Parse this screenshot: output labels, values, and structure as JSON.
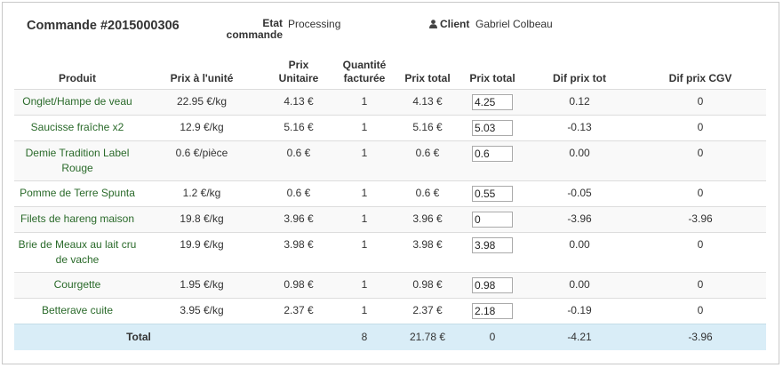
{
  "order": {
    "title": "Commande #2015000306",
    "etat_label": "Etat commande",
    "etat_value": "Processing",
    "client_label": "Client",
    "client_value": "Gabriel Colbeau"
  },
  "table": {
    "headers": {
      "produit": "Produit",
      "prix_unite": "Prix à l'unité",
      "prix_unitaire": "Prix Unitaire",
      "quantite": "Quantité facturée",
      "prix_total": "Prix total",
      "prix_total_input": "Prix total",
      "dif_tot": "Dif prix tot",
      "dif_cgv": "Dif prix CGV"
    },
    "rows": [
      {
        "produit": "Onglet/Hampe de veau",
        "prix_unite": "22.95 €/kg",
        "prix_unitaire": "4.13 €",
        "quantite": "1",
        "prix_total": "4.13 €",
        "input": "4.25",
        "dif_tot": "0.12",
        "dif_cgv": "0"
      },
      {
        "produit": "Saucisse fraîche x2",
        "prix_unite": "12.9 €/kg",
        "prix_unitaire": "5.16 €",
        "quantite": "1",
        "prix_total": "5.16 €",
        "input": "5.03",
        "dif_tot": "-0.13",
        "dif_cgv": "0"
      },
      {
        "produit": "Demie Tradition Label Rouge",
        "prix_unite": "0.6 €/pièce",
        "prix_unitaire": "0.6 €",
        "quantite": "1",
        "prix_total": "0.6 €",
        "input": "0.6",
        "dif_tot": "0.00",
        "dif_cgv": "0"
      },
      {
        "produit": "Pomme de Terre Spunta",
        "prix_unite": "1.2 €/kg",
        "prix_unitaire": "0.6 €",
        "quantite": "1",
        "prix_total": "0.6 €",
        "input": "0.55",
        "dif_tot": "-0.05",
        "dif_cgv": "0"
      },
      {
        "produit": "Filets de hareng maison",
        "prix_unite": "19.8 €/kg",
        "prix_unitaire": "3.96 €",
        "quantite": "1",
        "prix_total": "3.96 €",
        "input": "0",
        "dif_tot": "-3.96",
        "dif_cgv": "-3.96"
      },
      {
        "produit": "Brie de Meaux au lait cru de vache",
        "prix_unite": "19.9 €/kg",
        "prix_unitaire": "3.98 €",
        "quantite": "1",
        "prix_total": "3.98 €",
        "input": "3.98",
        "dif_tot": "0.00",
        "dif_cgv": "0"
      },
      {
        "produit": "Courgette",
        "prix_unite": "1.95 €/kg",
        "prix_unitaire": "0.98 €",
        "quantite": "1",
        "prix_total": "0.98 €",
        "input": "0.98",
        "dif_tot": "0.00",
        "dif_cgv": "0"
      },
      {
        "produit": "Betterave cuite",
        "prix_unite": "3.95 €/kg",
        "prix_unitaire": "2.37 €",
        "quantite": "1",
        "prix_total": "2.37 €",
        "input": "2.18",
        "dif_tot": "-0.19",
        "dif_cgv": "0"
      }
    ],
    "total": {
      "label": "Total",
      "prix_unite": "",
      "prix_unitaire": "",
      "quantite": "8",
      "prix_total": "21.78 €",
      "prix_total_input": "0",
      "dif_tot": "-4.21",
      "dif_cgv": "-3.96"
    }
  }
}
